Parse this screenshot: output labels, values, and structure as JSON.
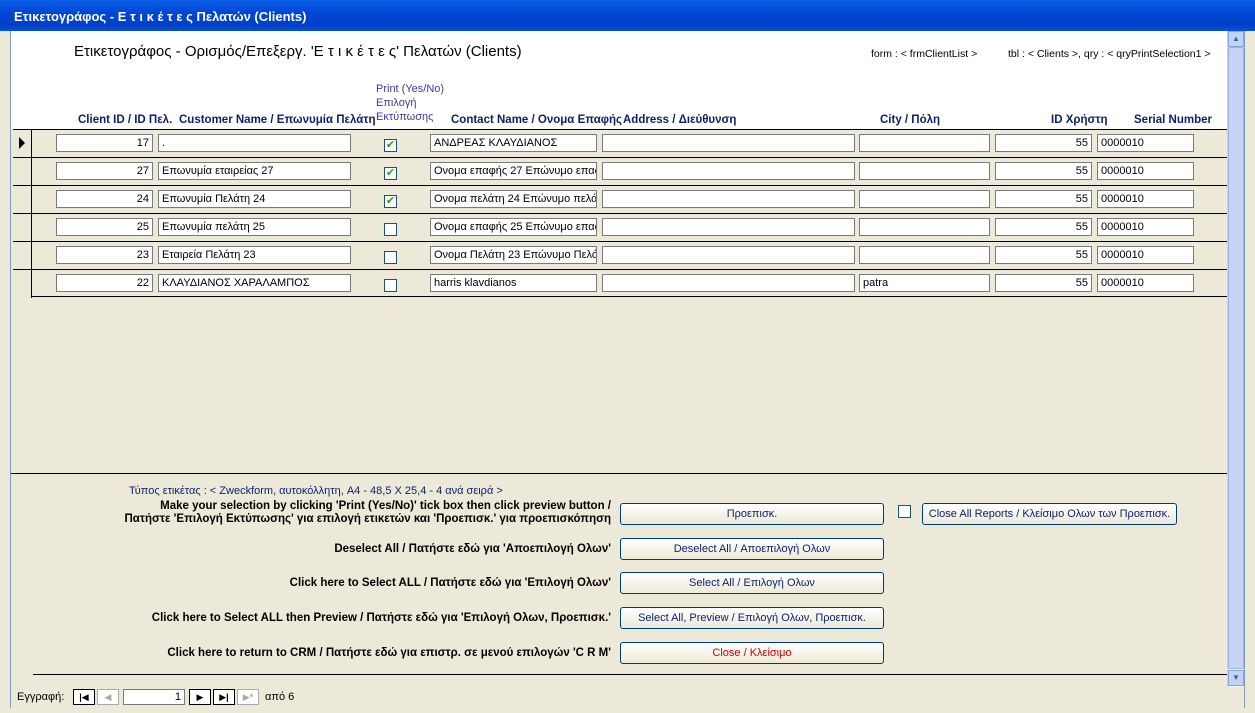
{
  "window": {
    "title": "Ετικετογράφος - Ε τ ι κ έ τ ε ς  Πελατών (Clients)"
  },
  "form": {
    "title": "Ετικετογράφος - Ορισμός/Επεξεργ. 'Ε τ ι κ έ τ ε ς' Πελατών (Clients)",
    "form_ref": "form : < frmClientList >",
    "table_ref": "tbl : < Clients >, qry : < qryPrintSelection1 >"
  },
  "columns": {
    "client_id": "Client ID / ID Πελ.",
    "customer_name": "Customer Name / Επωνυμία Πελάτη",
    "print_line1": "Print (Yes/No)",
    "print_line2": "Επιλογή",
    "print_line3": "Εκτύπωσης",
    "contact_name": "Contact Name / Ονομα Επαφής",
    "address": "Address / Διεύθυνση",
    "city": "City / Πόλη",
    "user_id": "ID Χρήστη",
    "serial": "Serial Number"
  },
  "rows": [
    {
      "client_id": "17",
      "customer_name": ".",
      "print": true,
      "contact_name": "ΑΝΔΡΕΑΣ ΚΛΑΥΔΙΑΝΟΣ",
      "address": "",
      "city": "",
      "user_id": "55",
      "serial": "0000010"
    },
    {
      "client_id": "27",
      "customer_name": "Επωνυμία εταιρείας 27",
      "print": true,
      "contact_name": "Ονομα επαφής 27 Επώνυμο επαφ",
      "address": "",
      "city": "",
      "user_id": "55",
      "serial": "0000010"
    },
    {
      "client_id": "24",
      "customer_name": "Επωνυμία Πελάτη 24",
      "print": true,
      "contact_name": "Ονομα πελάτη 24 Επώνυμο πελά'",
      "address": "",
      "city": "",
      "user_id": "55",
      "serial": "0000010"
    },
    {
      "client_id": "25",
      "customer_name": "Επωνυμία πελάτη 25",
      "print": false,
      "contact_name": "Ονομα επαφής 25 Επώνυμο επαφ",
      "address": "",
      "city": "",
      "user_id": "55",
      "serial": "0000010"
    },
    {
      "client_id": "23",
      "customer_name": "Εταιρεία Πελάτη 23",
      "print": false,
      "contact_name": "Ονομα Πελάτη 23 Επώνυμο Πελά",
      "address": "",
      "city": "",
      "user_id": "55",
      "serial": "0000010"
    },
    {
      "client_id": "22",
      "customer_name": "ΚΛΑΥΔΙΑΝΟΣ ΧΑΡΑΛΑΜΠΟΣ",
      "print": false,
      "contact_name": "harris klavdianos",
      "address": "",
      "city": "patra",
      "user_id": "55",
      "serial": "0000010"
    }
  ],
  "footer": {
    "label_type": "Τύπος ετικέτας : < Zweckform, αυτοκόλλητη,  A4 - 48,5 X 25,4 - 4 ανά σειρά >",
    "instr_preview_1": "Make your selection by clicking 'Print (Yes/No)' tick box then click preview button /",
    "instr_preview_2": "Πατήστε 'Επιλογή Εκτύπωσης' για επιλογή ετικετών και 'Προεπισκ.' για προεπισκόπηση",
    "instr_deselect": "Deselect All / Πατήστε εδώ για 'Αποεπιλογή Ολων'",
    "instr_select": "Click here to Select ALL / Πατήστε εδώ για 'Επιλογή Ολων'",
    "instr_select_preview": "Click here to Select ALL then Preview / Πατήστε εδώ για 'Επιλογή Ολων, Προεπισκ.'",
    "instr_close": "Click here to return to CRM / Πατήστε εδώ για επιστρ. σε μενού επιλογών 'C R M'",
    "btn_preview": "Προεπισκ.",
    "btn_close_reports": "Close All Reports /  Κλείσιμο Ολων των Προεπισκ.",
    "btn_deselect": "Deselect All / Αποεπιλογή Ολων",
    "btn_select": "Select All / Επιλογή Ολων",
    "btn_select_preview": "Select All, Preview / Επιλογή Ολων, Προεπισκ.",
    "btn_close": "Close / Κλείσιμο"
  },
  "navigation": {
    "label": "Εγγραφή:",
    "current": "1",
    "of_text": "από 6"
  },
  "colors": {
    "title_bar": "#0046d5",
    "check": "#21a121",
    "close_text": "#cc0000"
  }
}
